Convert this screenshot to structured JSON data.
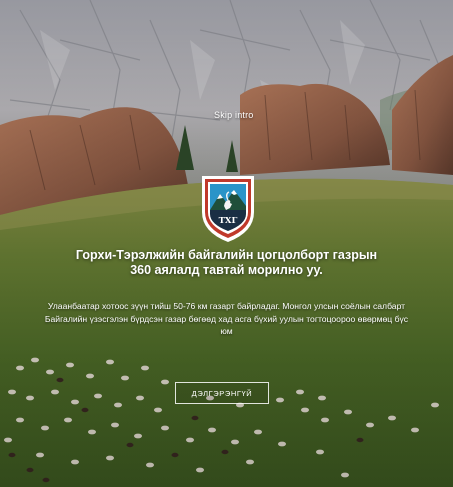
{
  "skip_intro": "Skip intro",
  "logo": {
    "icon": "mountain-ibex-emblem",
    "text": "ТХГ",
    "colors": {
      "shield": "#c0392b",
      "sky": "#2a94c8",
      "mountain": "#1f4f3a",
      "snow": "#ffffff"
    }
  },
  "hero": {
    "headline_line1": "Горхи-Тэрэлжийн байгалийн цогцолборт газрын",
    "headline_line2": "360 аялалд тавтай морилно уу.",
    "description": "Улаанбаатар хотоос зүүн тийш 50-76 км газарт байрладаг. Монгол улсын соёлын салбарт Байгалийн үзэсгэлэн бүрдсэн газар бөгөөд хад асга бүхий уулын тогтоцоороо өвөрмөц бүс юм",
    "more_label": "ДЭЛГЭРЭНГҮЙ"
  },
  "colors": {
    "text": "#ffffff",
    "grass": "#5b7a2e",
    "sky_rock": "#b8b6b8"
  }
}
